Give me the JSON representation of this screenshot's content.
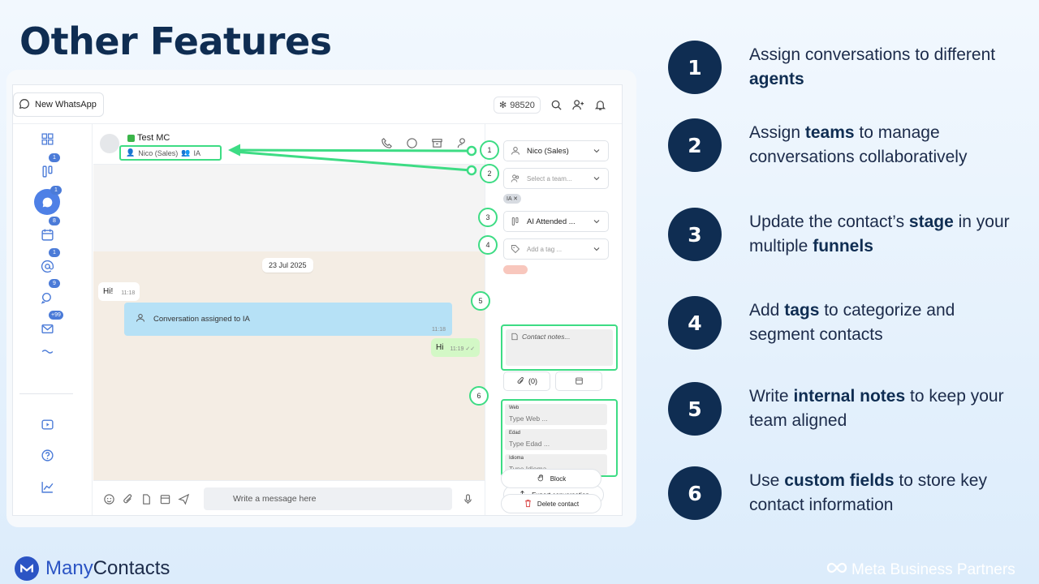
{
  "slide": {
    "title": "Other Features"
  },
  "topbar": {
    "new_whatsapp_label": "New WhatsApp",
    "counter": "98520"
  },
  "rail": {
    "badges": [
      "1",
      "1",
      "8",
      "1",
      "9",
      "+99"
    ]
  },
  "chat": {
    "contact_name": "Test MC",
    "assigned_agent": "Nico (Sales)",
    "assigned_team": "IA",
    "date_chip": "23 Jul 2025",
    "messages": [
      {
        "type": "incoming",
        "text": "Hi!",
        "time": "11:18"
      },
      {
        "type": "system",
        "text": "Conversation assigned to IA",
        "time": "11:18"
      },
      {
        "type": "outgoing",
        "text": "Hi",
        "time": "11:19"
      }
    ],
    "composer_placeholder": "Write a message here"
  },
  "sidebar": {
    "agent_select": "Nico (Sales)",
    "team_placeholder": "Select a team...",
    "team_chip": "IA",
    "stage_select": "AI Attended ...",
    "tag_placeholder": "Add a tag ...",
    "notes_placeholder": "Contact notes...",
    "attachments_count": "(0)",
    "custom_fields": [
      {
        "label": "Web",
        "placeholder": "Type Web ..."
      },
      {
        "label": "Edad",
        "placeholder": "Type Edad ..."
      },
      {
        "label": "Idioma",
        "placeholder": "Type Idioma ..."
      }
    ],
    "export_label": "Export conversation",
    "block_label": "Block",
    "delete_label": "Delete contact"
  },
  "markers": [
    "1",
    "2",
    "3",
    "4",
    "5",
    "6"
  ],
  "features": [
    {
      "num": "1",
      "parts": [
        "Assign conversations to different ",
        "agents",
        ""
      ]
    },
    {
      "num": "2",
      "parts": [
        "Assign ",
        "teams",
        " to manage conversations collaboratively"
      ]
    },
    {
      "num": "3",
      "parts": [
        "Update the contact’s ",
        "stage",
        " in your multiple ",
        "funnels",
        ""
      ]
    },
    {
      "num": "4",
      "parts": [
        "Add ",
        "tags",
        " to categorize and segment contacts"
      ]
    },
    {
      "num": "5",
      "parts": [
        "Write ",
        "internal notes",
        " to keep your team aligned"
      ]
    },
    {
      "num": "6",
      "parts": [
        "Use ",
        "custom fields",
        " to store key contact information"
      ]
    }
  ],
  "footer": {
    "brand_part1": "Many",
    "brand_part2": "Contacts",
    "partner": "Meta Business Partners"
  },
  "colors": {
    "navy": "#0f2d52",
    "highlight_green": "#3ddc84",
    "brand_blue": "#2b54c4"
  }
}
